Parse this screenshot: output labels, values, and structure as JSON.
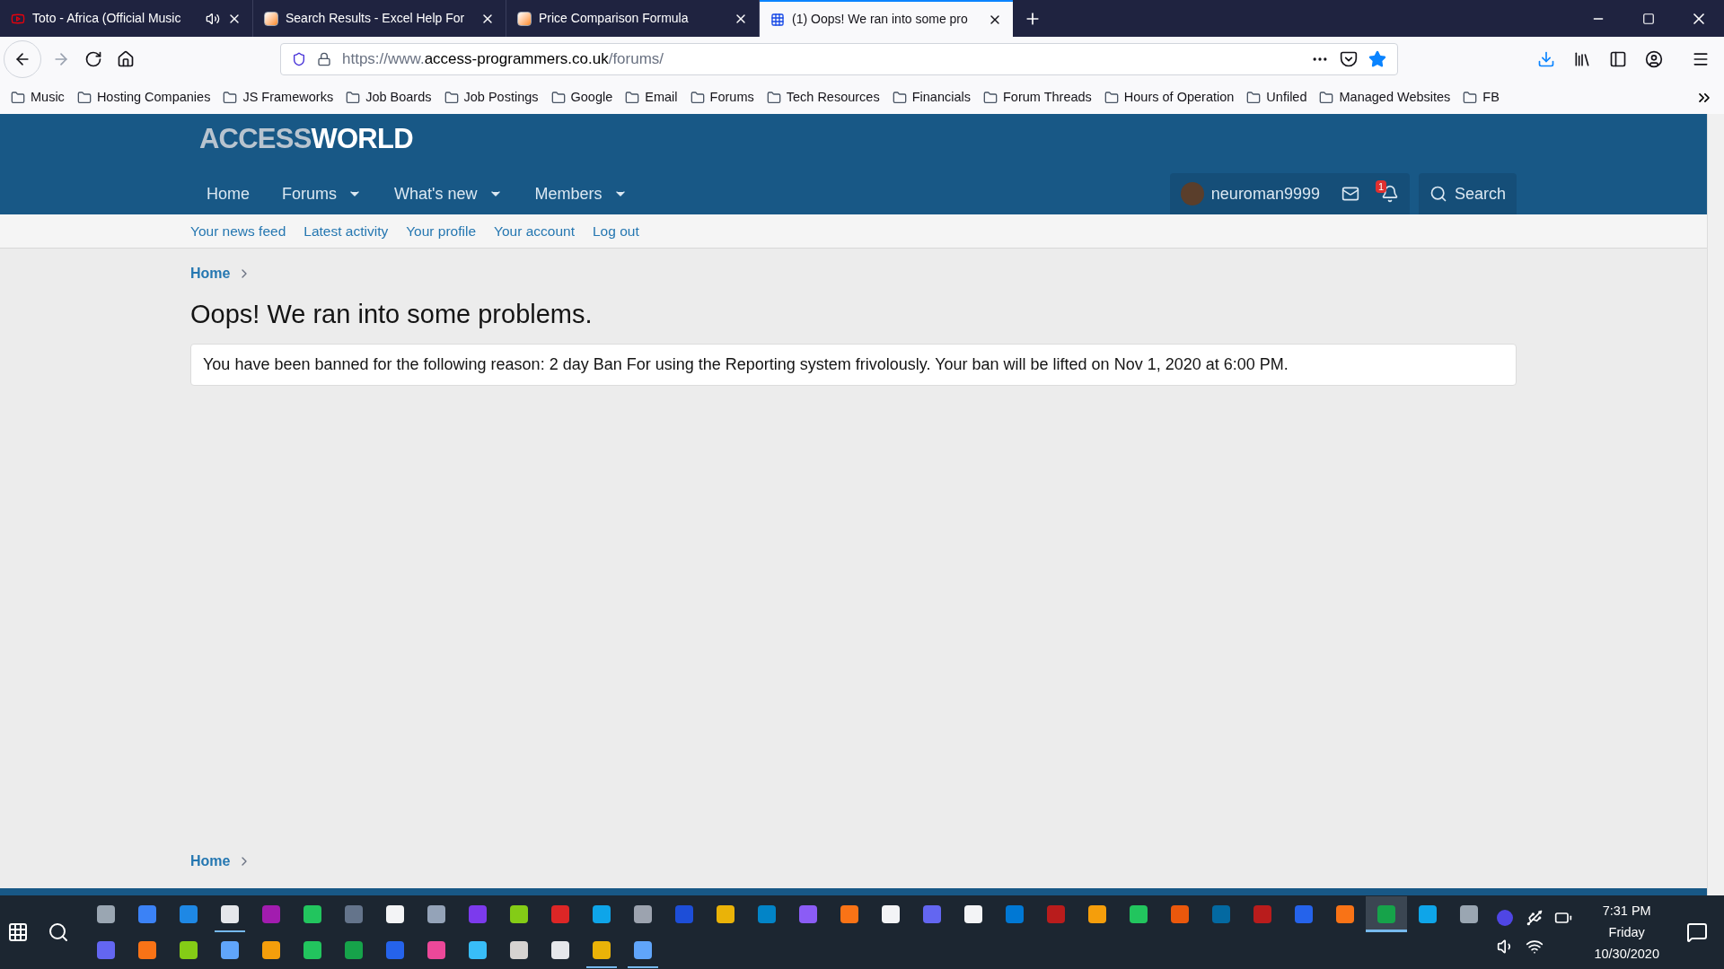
{
  "browser_tabs": [
    {
      "title": "Toto - Africa (Official Music",
      "kind": "video",
      "audio": true,
      "selected": false
    },
    {
      "title": "Search Results - Excel Help For",
      "kind": "ex",
      "audio": false,
      "selected": false
    },
    {
      "title": "Price Comparison Formula",
      "kind": "ex",
      "audio": false,
      "selected": false
    },
    {
      "title": "(1) Oops! We ran into some pro",
      "kind": "grid",
      "audio": false,
      "selected": true
    }
  ],
  "address_bar": {
    "prefix": "https://www.",
    "domain": "access-programmers.co.uk",
    "path": "/forums/",
    "bookmarked": true
  },
  "bookmarks": [
    "Music",
    "Hosting Companies",
    "JS Frameworks",
    "Job Boards",
    "Job Postings",
    "Google",
    "Email",
    "Forums",
    "Tech Resources",
    "Financials",
    "Forum Threads",
    "Hours of Operation",
    "Unfiled",
    "Managed Websites",
    "FB"
  ],
  "site": {
    "logo_part_1": "ACCESS",
    "logo_part_2": "WORLD",
    "nav": [
      {
        "label": "Home",
        "dropdown": false
      },
      {
        "label": "Forums",
        "dropdown": true
      },
      {
        "label": "What's new",
        "dropdown": true
      },
      {
        "label": "Members",
        "dropdown": true
      }
    ],
    "username": "neuroman9999",
    "alert_count": "1",
    "search_label": "Search",
    "subnav": [
      "Your news feed",
      "Latest activity",
      "Your profile",
      "Your account",
      "Log out"
    ],
    "breadcrumb": "Home",
    "heading": "Oops! We ran into some problems.",
    "message": "You have been banned for the following reason: 2 day Ban For using the Reporting system frivolously. Your ban will be lifted on Nov 1, 2020 at 6:00 PM.",
    "footer_breadcrumb": "Home"
  },
  "taskbar": {
    "row_1": [
      {
        "running": false,
        "selected": false
      },
      {
        "running": false,
        "selected": false
      },
      {
        "running": false,
        "selected": false
      },
      {
        "running": true,
        "selected": false
      },
      {
        "running": false,
        "selected": false
      },
      {
        "running": false,
        "selected": false
      },
      {
        "running": false,
        "selected": false
      },
      {
        "running": false,
        "selected": false
      },
      {
        "running": false,
        "selected": false
      },
      {
        "running": false,
        "selected": false
      },
      {
        "running": false,
        "selected": false
      },
      {
        "running": false,
        "selected": false
      },
      {
        "running": false,
        "selected": false
      },
      {
        "running": false,
        "selected": false
      },
      {
        "running": false,
        "selected": false
      },
      {
        "running": false,
        "selected": false
      },
      {
        "running": false,
        "selected": false
      },
      {
        "running": false,
        "selected": false
      },
      {
        "running": false,
        "selected": false
      },
      {
        "running": false,
        "selected": false
      },
      {
        "running": false,
        "selected": false
      },
      {
        "running": false,
        "selected": false
      },
      {
        "running": false,
        "selected": false
      },
      {
        "running": false,
        "selected": false
      },
      {
        "running": false,
        "selected": false
      },
      {
        "running": false,
        "selected": false
      },
      {
        "running": false,
        "selected": false
      },
      {
        "running": false,
        "selected": false
      },
      {
        "running": false,
        "selected": false
      },
      {
        "running": false,
        "selected": false
      },
      {
        "running": false,
        "selected": false
      },
      {
        "running": true,
        "selected": true
      },
      {
        "running": false,
        "selected": false
      },
      {
        "running": false,
        "selected": false
      }
    ],
    "row_2": [
      {
        "running": false,
        "selected": false
      },
      {
        "running": false,
        "selected": false
      },
      {
        "running": false,
        "selected": false
      },
      {
        "running": false,
        "selected": false
      },
      {
        "running": false,
        "selected": false
      },
      {
        "running": false,
        "selected": false
      },
      {
        "running": false,
        "selected": false
      },
      {
        "running": false,
        "selected": false
      },
      {
        "running": false,
        "selected": false
      },
      {
        "running": false,
        "selected": false
      },
      {
        "running": false,
        "selected": false
      },
      {
        "running": false,
        "selected": false
      },
      {
        "running": true,
        "selected": false
      },
      {
        "running": true,
        "selected": false
      }
    ],
    "time": "7:31 PM",
    "day": "Friday",
    "date": "10/30/2020"
  }
}
